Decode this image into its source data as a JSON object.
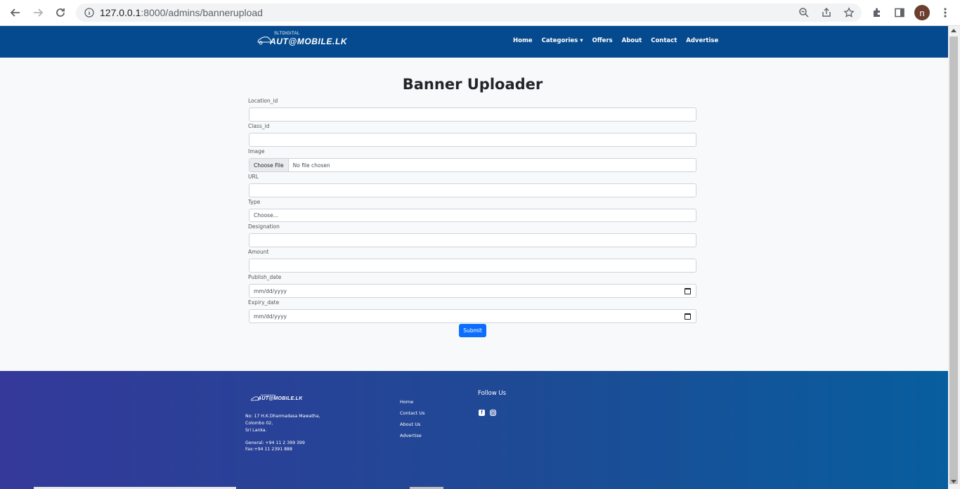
{
  "browser": {
    "url_host": "127.0.0.1",
    "url_rest": ":8000/admins/bannerupload",
    "avatar_letter": "n"
  },
  "header": {
    "logo_small": "SLTDIGITAL",
    "logo_big": "AUT@MOBILE.LK",
    "nav": [
      "Home",
      "Categories ▾",
      "Offers",
      "About",
      "Contact",
      "Advertise"
    ]
  },
  "form": {
    "title": "Banner Uploader",
    "fields": [
      {
        "label": "Location_id",
        "value": ""
      },
      {
        "label": "Class_id",
        "value": ""
      },
      {
        "label": "Image",
        "button": "Choose File",
        "value": "No file chosen"
      },
      {
        "label": "URL",
        "value": ""
      },
      {
        "label": "Type",
        "value": "Choose..."
      },
      {
        "label": "Designation",
        "value": ""
      },
      {
        "label": "Amount",
        "value": ""
      },
      {
        "label": "Publish_date",
        "value": "mm/dd/yyyy"
      },
      {
        "label": "Expiry_date",
        "value": "mm/dd/yyyy"
      }
    ],
    "submit_label": "Submit"
  },
  "footer": {
    "logo_small": "SLTDIGITAL",
    "logo_big": "AUT@MOBILE.LK",
    "address_1": "No: 17 H.K.Dharmadasa Mawatha,",
    "address_2": "Colombo 02,",
    "address_3": "Sri Lanka.",
    "phone": "General: +94 11 2 399 399",
    "fax": "Fax:+94 11 2391 888",
    "links": [
      "Home",
      "Contact Us",
      "About Us",
      "Advertise"
    ],
    "follow_title": "Follow Us"
  },
  "colors": {
    "header": "#054a8e",
    "primary": "#0d6efd"
  }
}
